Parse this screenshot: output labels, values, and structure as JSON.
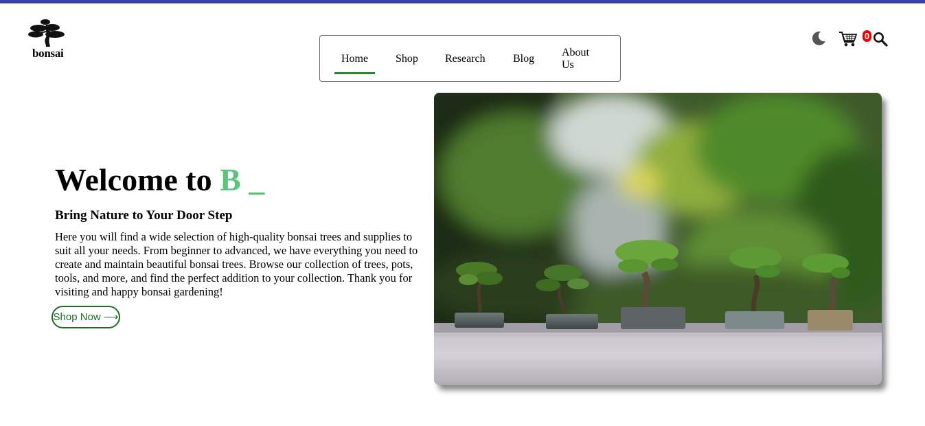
{
  "header": {
    "logo_text": "bonsai",
    "nav": [
      {
        "label": "Home",
        "active": true
      },
      {
        "label": "Shop",
        "active": false
      },
      {
        "label": "Research",
        "active": false
      },
      {
        "label": "Blog",
        "active": false
      },
      {
        "label": "About Us",
        "active": false
      }
    ],
    "icons": {
      "theme_toggle": "moon-icon",
      "cart": "cart-icon",
      "search": "search-icon"
    },
    "cart_count": "0"
  },
  "hero": {
    "title_prefix": "Welcome to ",
    "title_accent": "B _",
    "subtitle": "Bring Nature to Your Door Step",
    "description": "Here you will find a wide selection of high-quality bonsai trees and supplies to suit all your needs. From beginner to advanced, we have everything you need to create and maintain beautiful bonsai trees. Browse our collection of trees, pots, tools, and more, and find the perfect addition to your collection. Thank you for visiting and happy bonsai gardening!",
    "cta_label": "Shop Now ⟶"
  },
  "colors": {
    "top_bar": "#3a3fa8",
    "accent": "#5bc47a",
    "active_underline": "#1f8a2a",
    "cta": "#1a6e22",
    "badge": "#ee0000"
  }
}
